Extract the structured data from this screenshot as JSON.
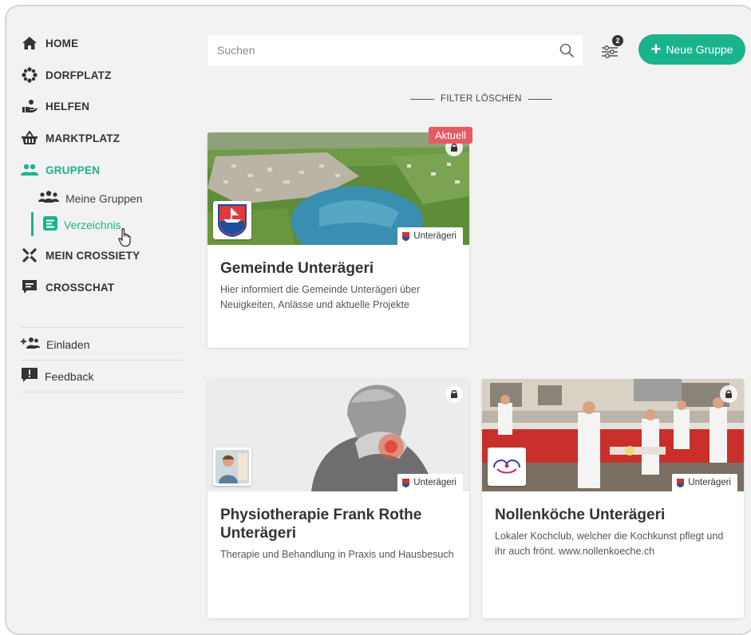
{
  "sidebar": {
    "nav": [
      {
        "label": "HOME",
        "icon": "home-icon"
      },
      {
        "label": "DORFPLATZ",
        "icon": "dorfplatz-icon"
      },
      {
        "label": "HELFEN",
        "icon": "helping-hand-icon"
      },
      {
        "label": "MARKTPLATZ",
        "icon": "basket-icon"
      },
      {
        "label": "GRUPPEN",
        "icon": "group-icon"
      }
    ],
    "sub": [
      {
        "label": "Meine Gruppen",
        "icon": "people-icon"
      },
      {
        "label": "Verzeichnis",
        "icon": "directory-icon"
      }
    ],
    "nav2": [
      {
        "label": "MEIN CROSSIETY",
        "icon": "crossiety-icon"
      },
      {
        "label": "CROSSCHAT",
        "icon": "chat-icon"
      }
    ],
    "invite_label": "Einladen",
    "feedback_label": "Feedback"
  },
  "topbar": {
    "search_placeholder": "Suchen",
    "filter_count": "2",
    "new_group_label": "Neue Gruppe",
    "filter_clear_label": "FILTER LÖSCHEN"
  },
  "cards": [
    {
      "title": "Gemeinde Unterägeri",
      "description": "Hier informiert die Gemeinde Unterägeri über Neuigkeiten, Anlässe und aktuelle Projekte",
      "location": "Unterägeri",
      "badge": "Aktuell"
    },
    {
      "title": "Physiotherapie Frank Rothe Unterägeri",
      "description": "Therapie und Behandlung in Praxis und Hausbesuch",
      "location": "Unterägeri"
    },
    {
      "title": "Nollenköche Unterägeri",
      "description": "Lokaler Kochclub, welcher die Kochkunst pflegt und ihr auch frönt. www.nollenkoeche.ch",
      "location": "Unterägeri"
    }
  ],
  "colors": {
    "accent": "#1bb38c",
    "badge": "#e75a63",
    "background": "#f2f2f2"
  }
}
